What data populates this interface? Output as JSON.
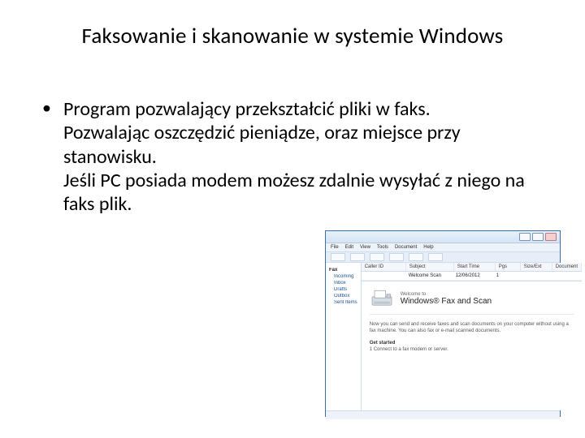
{
  "slide": {
    "title": "Faksowanie i skanowanie w systemie Windows",
    "bullet": {
      "line1": "Program pozwalający przekształcić pliki w faks.",
      "line2": "Pozwalając oszczędzić pieniądze, oraz miejsce przy stanowisku.",
      "line3": "Jeśli PC posiada modem możesz zdalnie wysyłać z niego na faks plik."
    }
  },
  "window": {
    "menu": {
      "m0": "File",
      "m1": "Edit",
      "m2": "View",
      "m3": "Tools",
      "m4": "Document",
      "m5": "Help"
    },
    "tree": {
      "root": "Fax",
      "n0": "Incoming",
      "n1": "Inbox",
      "n2": "Drafts",
      "n3": "Outbox",
      "n4": "Sent Items"
    },
    "columns": {
      "c0": "Caller ID",
      "c1": "Subject",
      "c2": "Start Time",
      "c3": "Pgs",
      "c4": "Size/Ext",
      "c5": "Document"
    },
    "row": {
      "c0": "",
      "c1": "Welcome Scan",
      "c2": "12/06/2012",
      "c3": "1",
      "c4": "",
      "c5": ""
    },
    "preview": {
      "brand_small": "Welcome to",
      "brand_big": "Windows® Fax and Scan",
      "body1": "Now you can send and receive faxes and scan documents on your computer without using a fax machine. You can also fax or e-mail scanned documents.",
      "steps_head": "Get started",
      "step1": "1    Connect to a fax modem or server."
    }
  }
}
